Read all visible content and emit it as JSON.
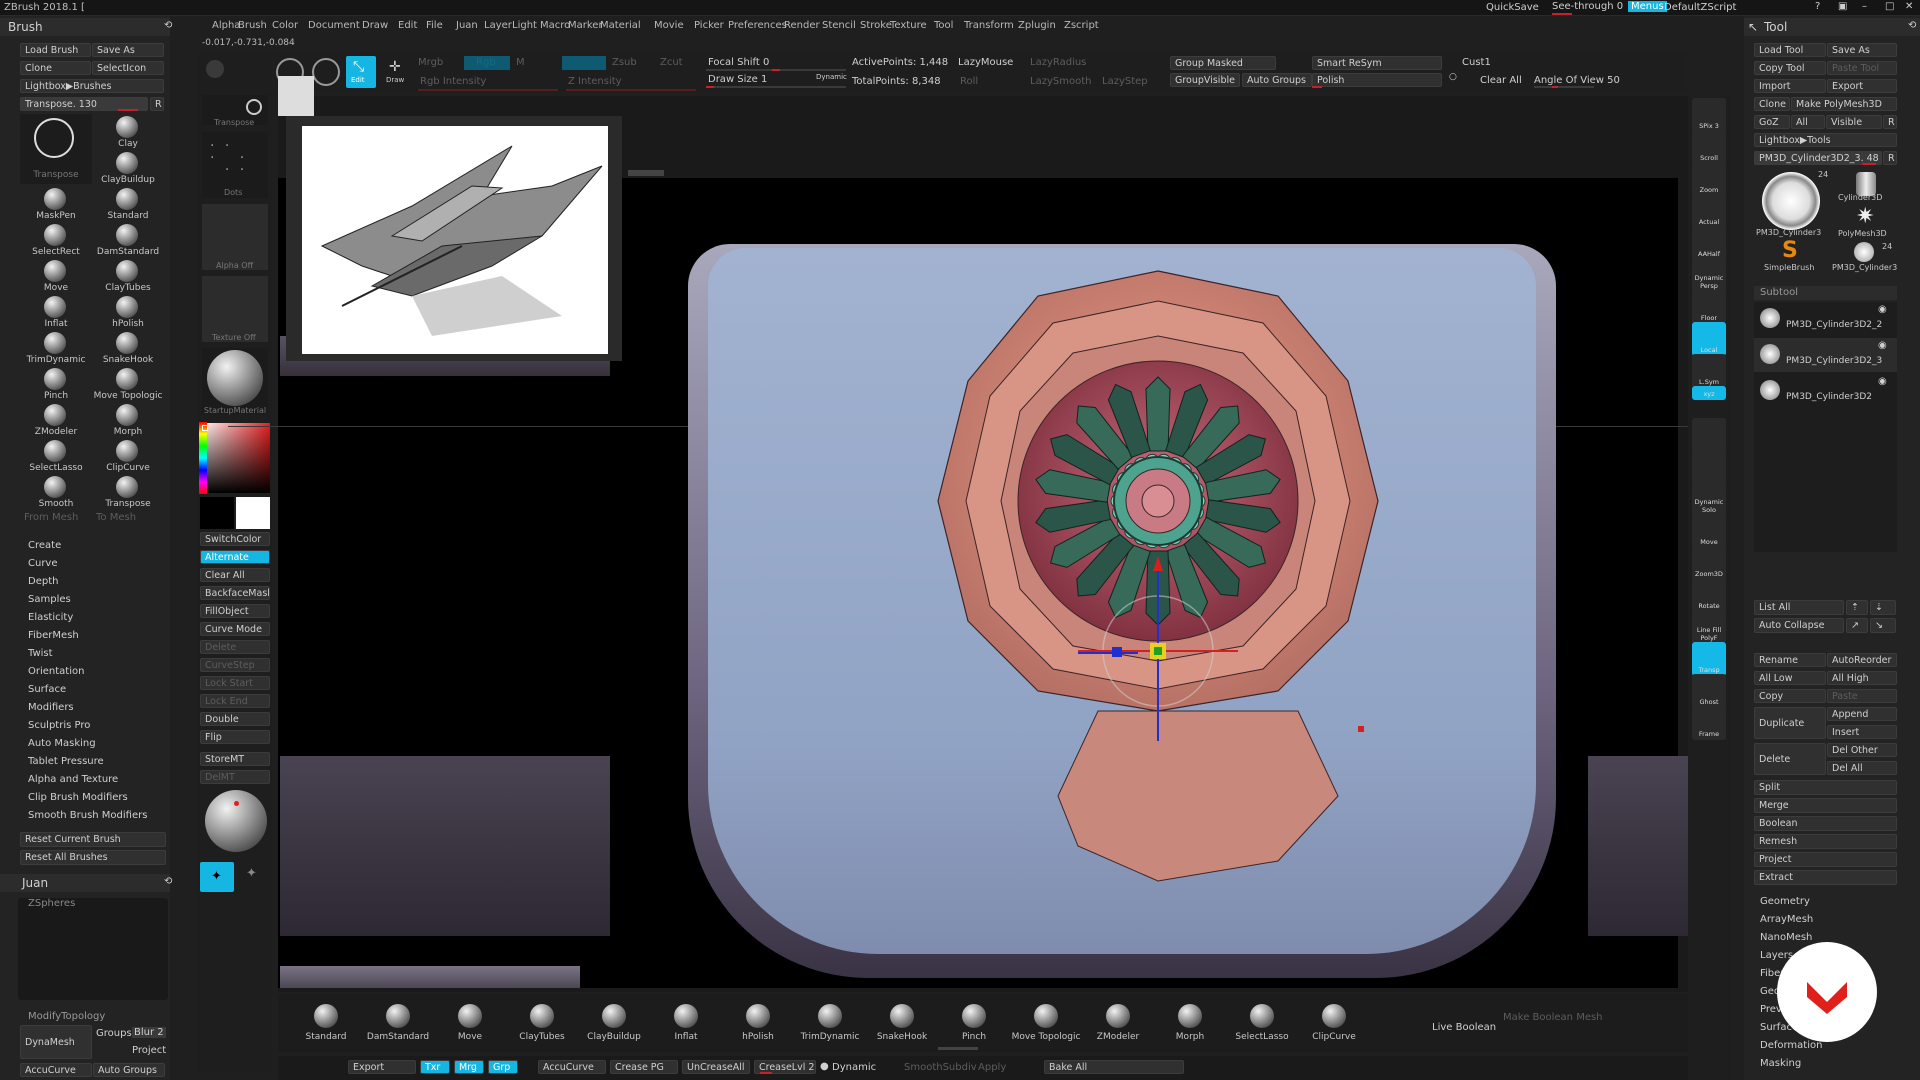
{
  "app": {
    "title": "ZBrush 2018.1 [",
    "quicksave": "QuickSave",
    "seethrough": "See-through 0",
    "menus": "Menus",
    "defaultzscript": "DefaultZScript"
  },
  "menubar": [
    "Alpha",
    "Brush",
    "Color",
    "Document",
    "Draw",
    "Edit",
    "File",
    "Juan",
    "Layer",
    "Light",
    "Macro",
    "Marker",
    "Material",
    "Movie",
    "Picker",
    "Preferences",
    "Render",
    "Stencil",
    "Stroke",
    "Texture",
    "Tool",
    "Transform",
    "Zplugin",
    "Zscript"
  ],
  "coords": "-0.017,-0.731,-0.084",
  "toolbar": {
    "edit": "Edit",
    "draw": "Draw",
    "mrgb": "Mrgb",
    "rgb": "Rgb",
    "m": "M",
    "zadd": "Zadd",
    "zsub": "Zsub",
    "zcut": "Zcut",
    "rgb_intensity": "Rgb Intensity",
    "z_intensity": "Z Intensity",
    "focal_shift": "Focal Shift 0",
    "draw_size": "Draw Size 1",
    "dynamic": "Dynamic",
    "active_points": "ActivePoints: 1,448",
    "total_points": "TotalPoints: 8,348",
    "lazymouse": "LazyMouse",
    "lazyradius": "LazyRadius",
    "lazysmooth": "LazySmooth",
    "lazystep": "LazyStep",
    "roll": "Roll",
    "group_masked": "Group Masked",
    "group_visible": "GroupVisible",
    "auto_groups": "Auto Groups",
    "smart_resym": "Smart ReSym",
    "polish": "Polish",
    "cust1": "Cust1",
    "clear_all": "Clear All",
    "angle_of_view": "Angle Of View 50"
  },
  "brush_panel": {
    "title": "Brush",
    "load": "Load Brush",
    "save": "Save As",
    "clone": "Clone",
    "selecticon": "SelectIcon",
    "lightbox": "Lightbox▶Brushes",
    "transpose": "Transpose. 130",
    "r": "R",
    "brushes": [
      "Transpose",
      "Clay",
      "ClayBuildup",
      "MaskPen",
      "Standard",
      "SelectRect",
      "DamStandard",
      "Move",
      "ClayTubes",
      "Inflat",
      "hPolish",
      "TrimDynamic",
      "SnakeHook",
      "Pinch",
      "Move Topologic",
      "ZModeler",
      "Morph",
      "SelectLasso",
      "ClipCurve",
      "Smooth",
      "Transpose"
    ],
    "from_mesh": "From Mesh",
    "to_mesh": "To Mesh",
    "sections": [
      "Create",
      "Curve",
      "Depth",
      "Samples",
      "Elasticity",
      "FiberMesh",
      "Twist",
      "Orientation",
      "Surface",
      "Modifiers",
      "Sculptris Pro",
      "Auto Masking",
      "Tablet Pressure",
      "Alpha and Texture",
      "Clip Brush Modifiers",
      "Smooth Brush Modifiers"
    ],
    "reset_current": "Reset Current Brush",
    "reset_all": "Reset All Brushes"
  },
  "juan_panel": {
    "title": "Juan",
    "zspheres": "ZSpheres",
    "modify_topology": "ModifyTopology",
    "dynamesh": "DynaMesh",
    "groups": "Groups",
    "blur": "Blur 2",
    "project": "Project",
    "accucurve": "AccuCurve",
    "auto_groups": "Auto Groups"
  },
  "shelf": {
    "transpose": "Transpose",
    "dots": "Dots",
    "alpha_off": "Alpha Off",
    "texture_off": "Texture Off",
    "startup_material": "StartupMaterial",
    "switchcolor": "SwitchColor",
    "alternate": "Alternate",
    "clear_all": "Clear All",
    "backfacemask": "BackfaceMask",
    "fillobject": "FillObject",
    "curve_mode": "Curve Mode",
    "delete": "Delete",
    "curvestep": "CurveStep",
    "lock_start": "Lock Start",
    "lock_end": "Lock End",
    "double": "Double",
    "flip": "Flip",
    "storemt": "StoreMT",
    "delmt": "DelMT"
  },
  "bottom_brushes": [
    "Standard",
    "DamStandard",
    "Move",
    "ClayTubes",
    "ClayBuildup",
    "Inflat",
    "hPolish",
    "TrimDynamic",
    "SnakeHook",
    "Pinch",
    "Move Topologic",
    "ZModeler",
    "Morph",
    "SelectLasso",
    "ClipCurve"
  ],
  "bottom_extra": {
    "live_boolean": "Live Boolean",
    "make_boolean": "Make Boolean Mesh"
  },
  "statusbar": {
    "export": "Export",
    "txr": "Txr",
    "mrg": "Mrg",
    "grp": "Grp",
    "accucurve": "AccuCurve",
    "crease_pg": "Crease PG",
    "uncrease_all": "UnCreaseAll",
    "creaselvl": "CreaseLvl 2",
    "dynamic": "Dynamic",
    "smoothsubdiv": "SmoothSubdiv",
    "apply": "Apply",
    "bake_all": "Bake All"
  },
  "right_icons": [
    "SPix 3",
    "Scroll",
    "Zoom",
    "Actual",
    "AAHalf",
    "Dynamic Persp",
    "Floor",
    "Local",
    "L.Sym",
    "xyz",
    "",
    "",
    "Dynamic Solo",
    "Move",
    "Zoom3D",
    "Rotate",
    "Line Fill PolyF",
    "Transp",
    "Ghost",
    "Frame"
  ],
  "tool_panel": {
    "title": "Tool",
    "load": "Load Tool",
    "save": "Save As",
    "copy": "Copy Tool",
    "paste": "Paste Tool",
    "import": "Import",
    "export": "Export",
    "clone": "Clone",
    "make_polymesh": "Make PolyMesh3D",
    "goz": "GoZ",
    "all": "All",
    "visible": "Visible",
    "r": "R",
    "lightbox": "Lightbox▶Tools",
    "current": "PM3D_Cylinder3D2_3. 48",
    "r2": "R",
    "thumbs": [
      "PM3D_Cylinder3",
      "Cylinder3D",
      "PolyMesh3D",
      "SimpleBrush",
      "PM3D_Cylinder3"
    ],
    "count1": "24",
    "count2": "24",
    "subtool": "Subtool",
    "subtools": [
      "PM3D_Cylinder3D2_2",
      "PM3D_Cylinder3D2_3",
      "PM3D_Cylinder3D2"
    ],
    "list_all": "List All",
    "auto_collapse": "Auto Collapse",
    "rename": "Rename",
    "autoreorder": "AutoReorder",
    "all_low": "All Low",
    "all_high": "All High",
    "copy2": "Copy",
    "paste2": "Paste",
    "duplicate": "Duplicate",
    "append": "Append",
    "insert": "Insert",
    "delete": "Delete",
    "del_other": "Del Other",
    "del_all": "Del All",
    "ops": [
      "Split",
      "Merge",
      "Boolean",
      "Remesh",
      "Project",
      "Extract"
    ],
    "sections": [
      "Geometry",
      "ArrayMesh",
      "NanoMesh",
      "Layers",
      "FiberMesh",
      "Geometry HD",
      "Preview",
      "Surface",
      "Deformation",
      "Masking"
    ]
  },
  "colors": {
    "accent": "#16b6e3",
    "red": "#c8202a",
    "mesh_pink": "#d69c8c",
    "fan_green": "#2f5a4c"
  }
}
